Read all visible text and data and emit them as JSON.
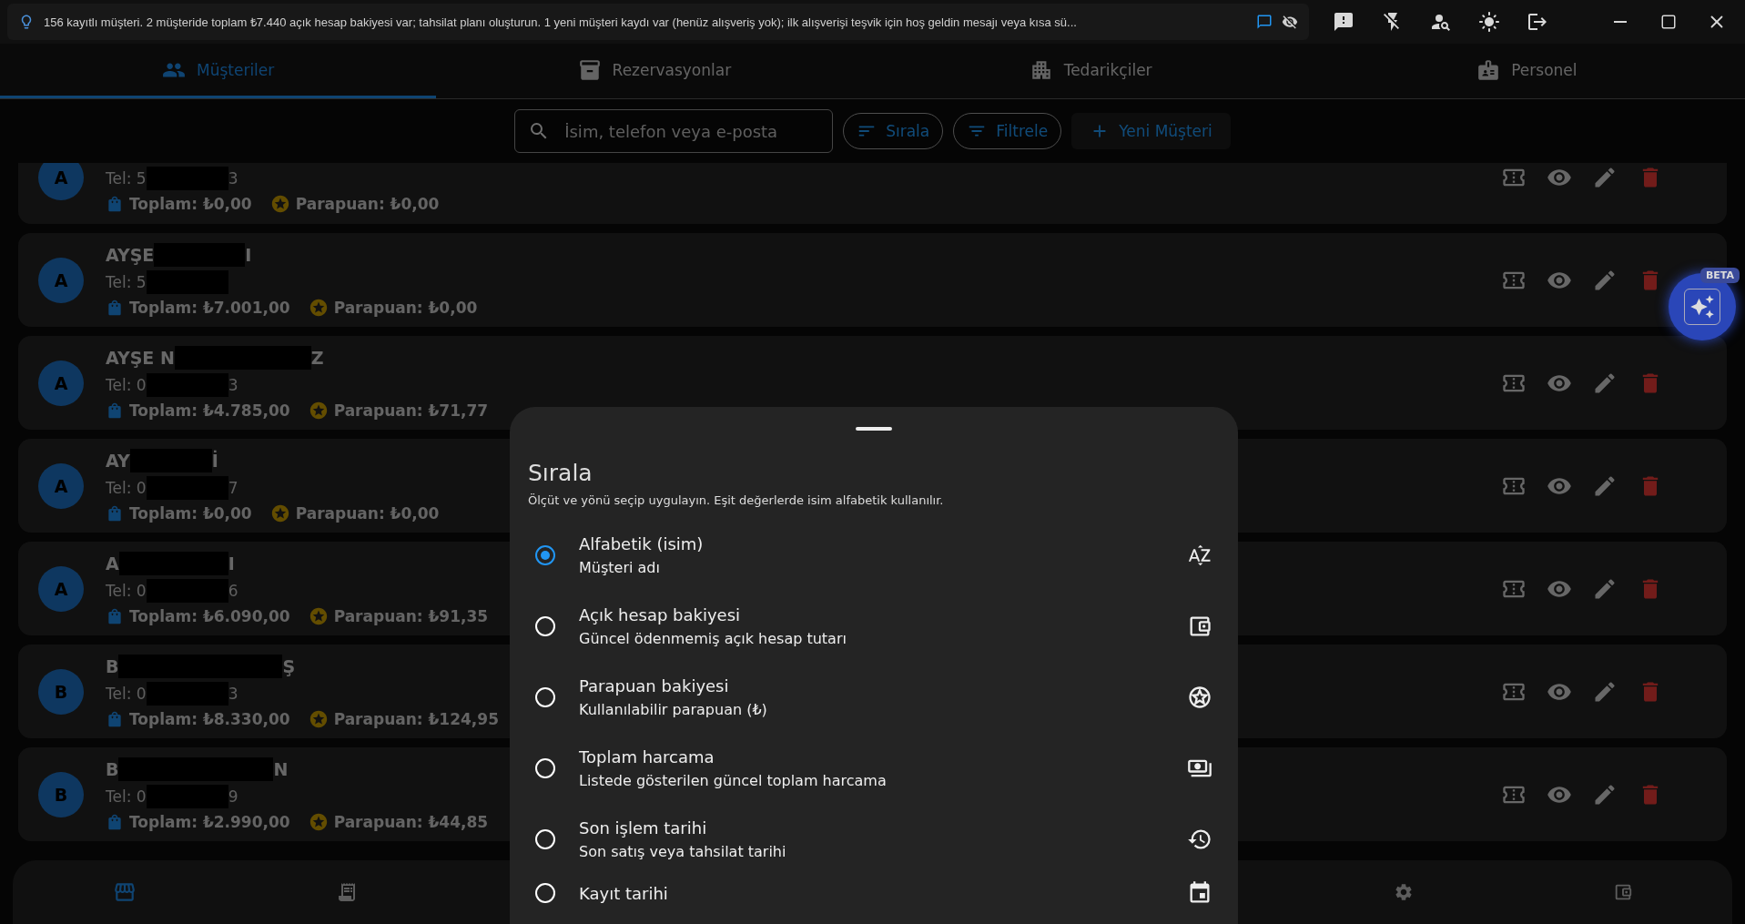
{
  "hint_bar": {
    "text": "156 kayıtlı müşteri. 2 müşteride toplam ₺7.440 açık hesap bakiyesi var; tahsilat planı oluşturun. 1 yeni müşteri kaydı var (henüz alışveriş yok); ilk alışverişi teşvik için hoş geldin mesajı veya kısa sü..."
  },
  "tabs": [
    {
      "label": "Müşteriler",
      "selected": true
    },
    {
      "label": "Rezervasyonlar",
      "selected": false
    },
    {
      "label": "Tedarikçiler",
      "selected": false
    },
    {
      "label": "Personel",
      "selected": false
    }
  ],
  "search": {
    "placeholder": "İsim, telefon veya e-posta"
  },
  "toolbar_buttons": [
    {
      "kind": "outline",
      "label": "Sırala"
    },
    {
      "kind": "outline",
      "label": "Filtrele"
    },
    {
      "kind": "filled",
      "label": "Yeni Müşteri"
    }
  ],
  "customers": [
    {
      "avatar": "A",
      "phone_start": "Tel: 5",
      "phone_end": "3",
      "total": "Toplam: ₺0,00",
      "points": "Parapuan: ₺0,00"
    },
    {
      "avatar": "A",
      "name_start": "AYŞE",
      "name_end": "I",
      "phone_start": "Tel: 5",
      "total": "Toplam: ₺7.001,00",
      "points": "Parapuan: ₺0,00"
    },
    {
      "avatar": "A",
      "name_start": "AYŞE N",
      "name_end": "Z",
      "phone_start": "Tel: 0",
      "phone_end": "3",
      "total": "Toplam: ₺4.785,00",
      "points": "Parapuan: ₺71,77"
    },
    {
      "avatar": "A",
      "name_start": "AY",
      "name_end": "İ",
      "phone_start": "Tel: 0",
      "phone_end": "7",
      "total": "Toplam: ₺0,00",
      "points": "Parapuan: ₺0,00"
    },
    {
      "avatar": "A",
      "name_start": "A",
      "name_end": "I",
      "phone_start": "Tel: 0",
      "phone_end": "6",
      "total": "Toplam: ₺6.090,00",
      "points": "Parapuan: ₺91,35"
    },
    {
      "avatar": "B",
      "name_start": "B",
      "name_end": "Ş",
      "phone_start": "Tel: 0",
      "phone_end": "3",
      "total": "Toplam: ₺8.330,00",
      "points": "Parapuan: ₺124,95"
    },
    {
      "avatar": "B",
      "name_start": "B",
      "name_end": "N",
      "phone_start": "Tel: 0",
      "phone_end": "9",
      "total": "Toplam: ₺2.990,00",
      "points": "Parapuan: ₺44,85"
    }
  ],
  "assistant_button": {
    "badge": "BETA"
  },
  "sort_sheet": {
    "title": "Sırala",
    "subtitle": "Ölçüt ve yönü seçip uygulayın. Eşit değerlerde isim alfabetik kullanılır.",
    "options": [
      {
        "kind": "alpha",
        "label": "Alfabetik (isim)",
        "description": "Müşteri adı",
        "selected": true
      },
      {
        "kind": "balance",
        "label": "Açık hesap bakiyesi",
        "description": "Güncel ödenmemiş açık hesap tutarı",
        "selected": false
      },
      {
        "kind": "points",
        "label": "Parapuan bakiyesi",
        "description": "Kullanılabilir parapuan (₺)",
        "selected": false
      },
      {
        "kind": "spend",
        "label": "Toplam harcama",
        "description": "Listede gösterilen güncel toplam harcama",
        "selected": false
      },
      {
        "kind": "recent",
        "label": "Son işlem tarihi",
        "description": "Son satış veya tahsilat tarihi",
        "selected": false
      },
      {
        "kind": "created",
        "label": "Kayıt tarihi",
        "selected": false
      }
    ]
  }
}
